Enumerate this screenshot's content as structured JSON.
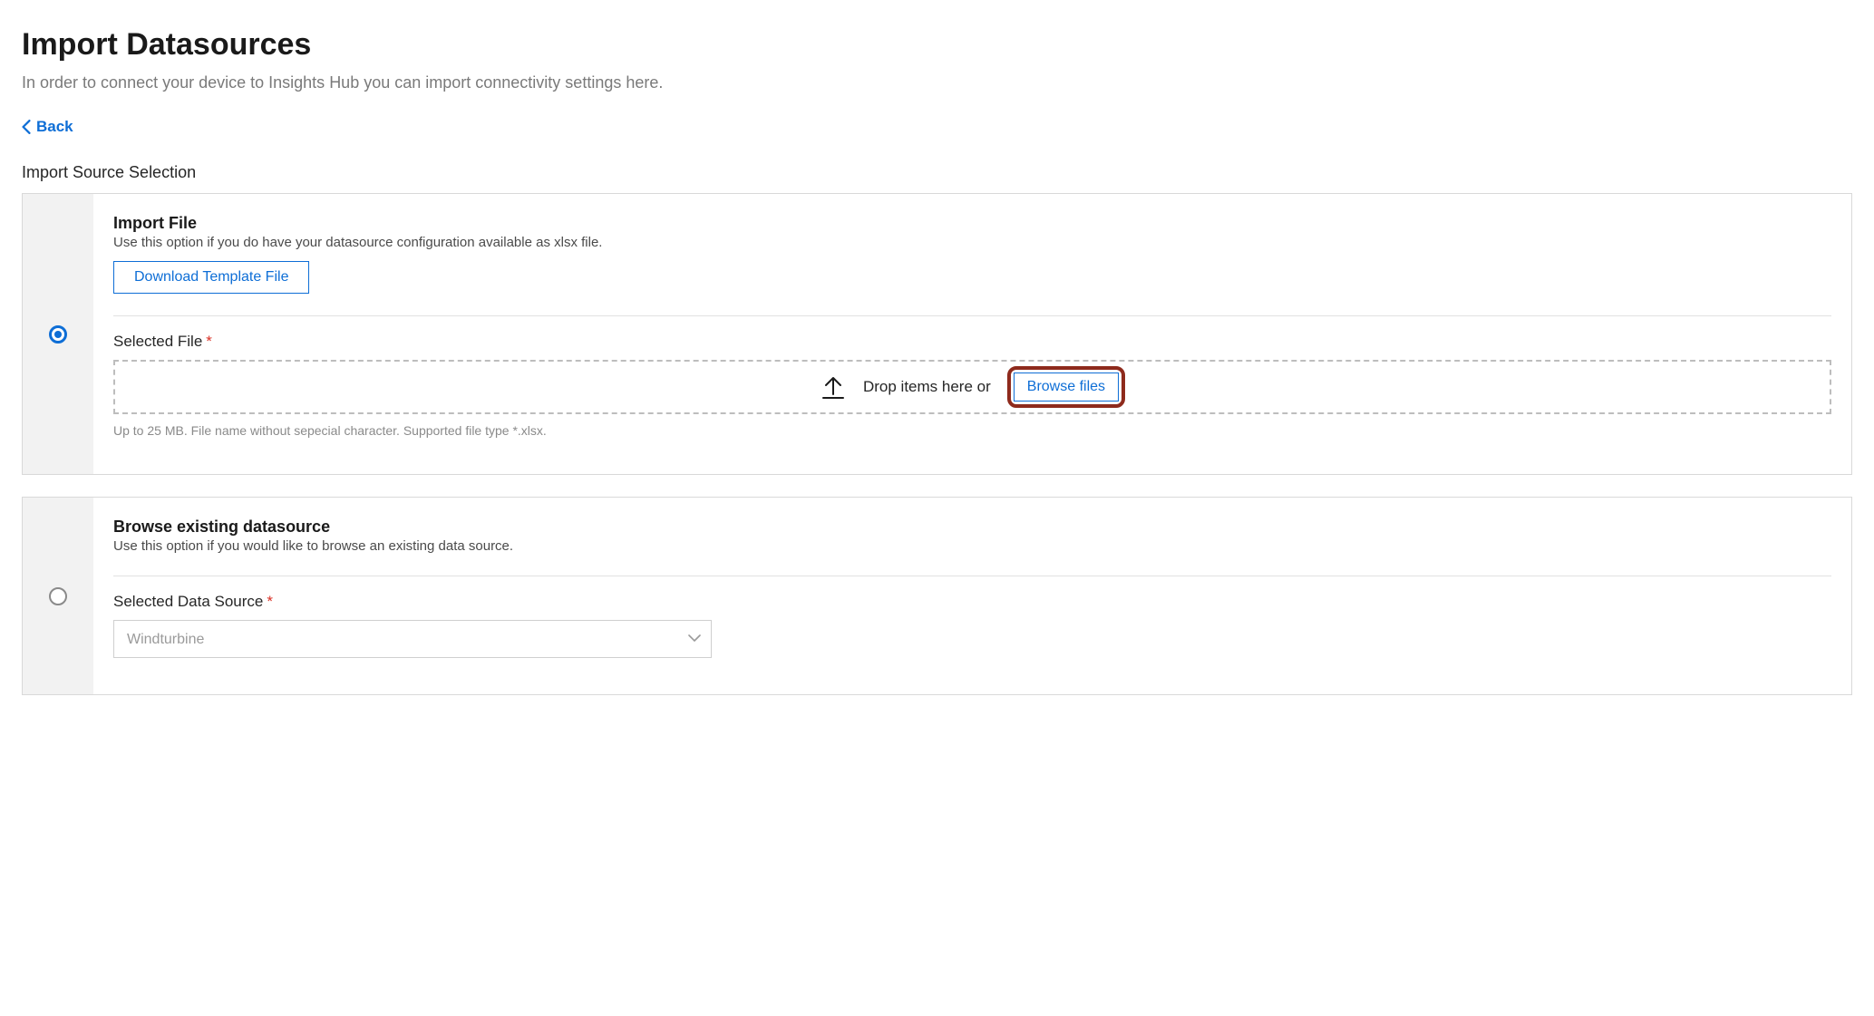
{
  "header": {
    "title": "Import Datasources",
    "subtitle": "In order to connect your device to Insights Hub you can import connectivity settings here.",
    "back_label": "Back"
  },
  "section": {
    "heading": "Import Source Selection"
  },
  "options": {
    "file": {
      "selected": true,
      "title": "Import File",
      "desc": "Use this option if you do have your datasource configuration available as xlsx file.",
      "download_label": "Download Template File",
      "field_label": "Selected File",
      "drop_text": "Drop items here or",
      "browse_label": "Browse files",
      "hint": "Up to 25 MB. File name without sepecial character. Supported file type *.xlsx."
    },
    "browse": {
      "selected": false,
      "title": "Browse existing datasource",
      "desc": "Use this option if you would like to browse an existing data source.",
      "field_label": "Selected Data Source",
      "placeholder": "Windturbine"
    }
  },
  "colors": {
    "accent": "#0e6ed6",
    "highlight": "#8e2a1c"
  }
}
